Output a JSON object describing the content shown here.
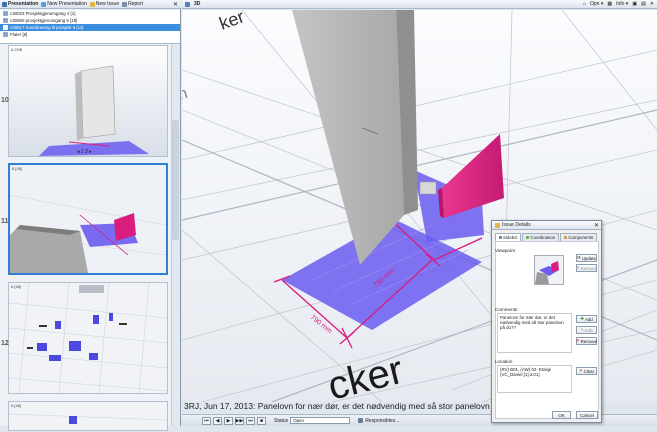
{
  "toolbar": {
    "presentation": "Presentation",
    "new_presentation": "New Presentation",
    "new_issue": "New Issue",
    "report": "Report"
  },
  "presentations": [
    {
      "label": "c30023 Prosjektgjenomgang 4 [1]",
      "selected": false
    },
    {
      "label": "c30650 prosjektgjenomgang 5 [18]",
      "selected": false
    },
    {
      "label": "c30617 Koordinering til prosjekt 6 [11]",
      "selected": true
    },
    {
      "label": "Flater [8]",
      "selected": false
    }
  ],
  "thumbnails": [
    {
      "label": "6.23\\$",
      "pager": "◂ 1 2 ▸",
      "row": "10"
    },
    {
      "label": "6.[48]",
      "row": "11"
    },
    {
      "label": "6.[48]",
      "row": "12"
    },
    {
      "label": "6.[48]",
      "row": ""
    }
  ],
  "viewport": {
    "title": "3D",
    "opn": "Opn",
    "info": "Info",
    "caption": "3RJ, Jun 17, 2013: Panelovn for nær dør, er det nødvendig med så stor panelovn på do??",
    "dim1": "790 mm",
    "dim2": "790 mm",
    "floor_word1": "rom",
    "floor_word2": "cker",
    "floor_word3": "ker"
  },
  "statusbar": {
    "status_label": "Status",
    "status_value": "Open",
    "responsibles": "Responsibles..."
  },
  "dialog": {
    "title": "Issue Details",
    "tabs": [
      "Sidebcl",
      "Coordination",
      "Components"
    ],
    "viewpoint_label": "Viewpoint",
    "update": "Update",
    "remove": "Remove",
    "comments_label": "Comments",
    "comment_text": "Panelovn for nær dør, er det nødvendig med så stor panelovn på do??",
    "add": "Add",
    "edit": "Edit",
    "remove2": "Remove",
    "location_label": "Location",
    "location_text": "(RV) B01, (AW) 02- Etasje (VC_Daniel [1].3.01]",
    "clear": "Clear",
    "ok": "OK",
    "cancel": "Cancel"
  },
  "colors": {
    "accent": "#3b8de0",
    "floor_blue": "#6a5cf0",
    "magenta": "#d91c7d",
    "panel_pink": "#e23a8f"
  }
}
